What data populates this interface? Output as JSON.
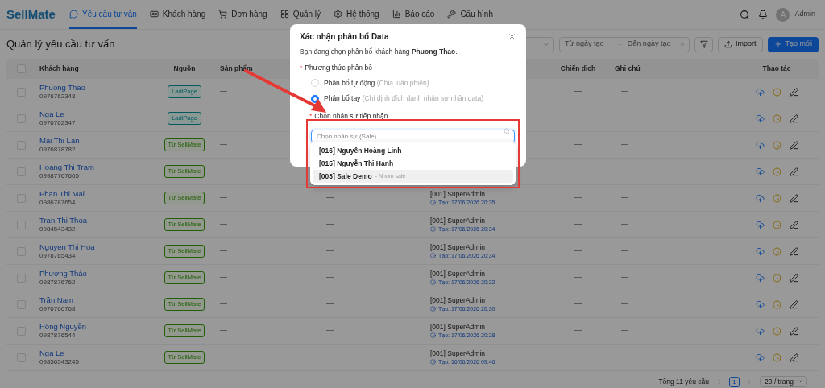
{
  "header": {
    "logo": "SellMate",
    "nav": [
      {
        "label": "Yêu cầu tư vấn",
        "selected": true
      },
      {
        "label": "Khách hàng",
        "selected": false
      },
      {
        "label": "Đơn hàng",
        "selected": false
      },
      {
        "label": "Quản lý",
        "selected": false
      },
      {
        "label": "Hệ thống",
        "selected": false
      },
      {
        "label": "Báo cáo",
        "selected": false
      },
      {
        "label": "Cấu hình",
        "selected": false
      }
    ],
    "avatar": "A",
    "user": "Admin"
  },
  "page_title": "Quản lý yêu cầu tư vấn",
  "toolbar": {
    "date_from": {
      "placeholder": "Từ ngày tạo"
    },
    "date_to": {
      "placeholder": "Đến ngày tạo"
    },
    "import": "Import",
    "create": "Tạo mới"
  },
  "table": {
    "select_all": {
      "checked": false
    },
    "columns": [
      "Khách hàng",
      "Nguồn",
      "Sản phẩm",
      "Chiến dịch",
      "Ghi chú",
      "Thao tác"
    ],
    "rows": [
      {
        "checked": false,
        "name": "Phuong Thao",
        "phone": "0976762348",
        "source": {
          "label": "LadiPage",
          "kind": "ladipage"
        },
        "product": "—",
        "campaign": "—",
        "note": "—"
      },
      {
        "checked": false,
        "name": "Nga Le",
        "phone": "0976762347",
        "source": {
          "label": "LadiPage",
          "kind": "ladipage"
        },
        "product": "—",
        "campaign": "—",
        "note": "—"
      },
      {
        "checked": false,
        "name": "Mai Thi Lan",
        "phone": "0976878782",
        "source": {
          "label": "Từ SellMate",
          "kind": "sellmate"
        },
        "product": "—",
        "campaign": "—",
        "note": "—"
      },
      {
        "checked": false,
        "name": "Hoang Thi Tram",
        "phone": "09987767665",
        "source": {
          "label": "Từ SellMate",
          "kind": "sellmate"
        },
        "product": "—",
        "campaign": "—",
        "note": "—"
      },
      {
        "checked": false,
        "name": "Phan Thi Mai",
        "phone": "0986787654",
        "source": {
          "label": "Từ SellMate",
          "kind": "sellmate"
        },
        "product": "—",
        "column_4": "—",
        "creator": "[001] SuperAdmin",
        "created": "Tạo: 17/06/2026 20:35",
        "campaign": "—",
        "note": "—"
      },
      {
        "checked": false,
        "name": "Tran Thi Thoa",
        "phone": "0984543432",
        "source": {
          "label": "Từ SellMate",
          "kind": "sellmate"
        },
        "product": "—",
        "column_4": "—",
        "creator": "[001] SuperAdmin",
        "created": "Tạo: 17/06/2026 20:34",
        "campaign": "—",
        "note": "—"
      },
      {
        "checked": false,
        "name": "Nguyen Thi Hoa",
        "phone": "0978765434",
        "source": {
          "label": "Từ SellMate",
          "kind": "sellmate"
        },
        "product": "—",
        "column_4": "—",
        "creator": "[001] SuperAdmin",
        "created": "Tạo: 17/06/2026 20:34",
        "campaign": "—",
        "note": "—"
      },
      {
        "checked": false,
        "name": "Phương Thảo",
        "phone": "0987876762",
        "source": {
          "label": "Từ SellMate",
          "kind": "sellmate"
        },
        "product": "—",
        "column_4": "—",
        "creator": "[001] SuperAdmin",
        "created": "Tạo: 17/06/2026 20:32",
        "campaign": "—",
        "note": "—"
      },
      {
        "checked": false,
        "name": "Trần Nam",
        "phone": "0976766768",
        "source": {
          "label": "Từ SellMate",
          "kind": "sellmate"
        },
        "product": "—",
        "column_4": "—",
        "creator": "[001] SuperAdmin",
        "created": "Tạo: 17/06/2026 20:30",
        "campaign": "—",
        "note": "—"
      },
      {
        "checked": false,
        "name": "Hồng Nguyễn",
        "phone": "0987876544",
        "source": {
          "label": "Từ SellMate",
          "kind": "sellmate"
        },
        "product": "—",
        "column_4": "—",
        "creator": "[001] SuperAdmin",
        "created": "Tạo: 17/06/2026 20:28",
        "campaign": "—",
        "note": "—"
      },
      {
        "checked": false,
        "name": "Nga Le",
        "phone": "09856543245",
        "source": {
          "label": "Từ SellMate",
          "kind": "sellmate"
        },
        "product": "—",
        "column_4": "—",
        "creator": "[001] SuperAdmin",
        "created": "Tạo: 16/06/2026 09:46",
        "campaign": "—",
        "note": "—"
      }
    ]
  },
  "pagination": {
    "total": "Tổng 11 yêu cầu",
    "pages": [
      {
        "label": "1",
        "selected": true
      }
    ],
    "page_size": "20 / trang"
  },
  "modal": {
    "title": "Xác nhận phân bổ Data",
    "message": "Bạn đang chọn phân bổ khách hàng **Phuong Thao**.",
    "required_mark": "*",
    "method_label": "Phương thức phân bổ",
    "options": [
      {
        "label": "Phân bổ tự động",
        "hint": "(Chia luân phiên)",
        "selected": false
      },
      {
        "label": "Phân bổ tay",
        "hint": "(Chỉ định đích danh nhân sự nhận data)",
        "selected": true
      }
    ],
    "staff_label": "Chọn nhân sự tiếp nhận",
    "staff_search": {
      "placeholder": "Chọn nhân sự (Sale)"
    },
    "staff_options": [
      {
        "label": "[016] Nguyễn Hoàng Linh",
        "selected": false
      },
      {
        "label": "[015] Nguyễn Thị Hạnh",
        "selected": false
      },
      {
        "label": "[003] Sale Demo",
        "group": "- Nhóm sale",
        "selected": true
      }
    ]
  }
}
